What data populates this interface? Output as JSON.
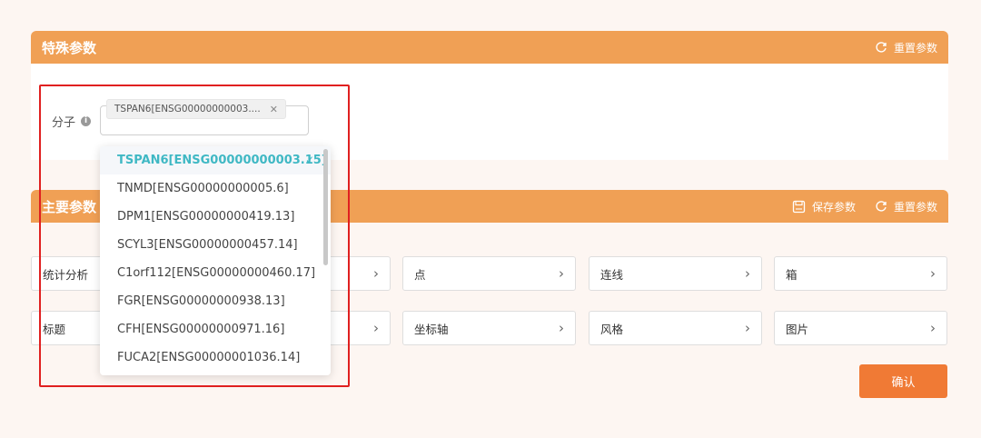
{
  "special_params": {
    "title": "特殊参数",
    "reset_label": "重置参数"
  },
  "molecule_field": {
    "label": "分子",
    "selected_tag": "TSPAN6[ENSG00000000003....",
    "options": [
      "TSPAN6[ENSG00000000003.15]",
      "TNMD[ENSG00000000005.6]",
      "DPM1[ENSG00000000419.13]",
      "SCYL3[ENSG00000000457.14]",
      "C1orf112[ENSG00000000460.17]",
      "FGR[ENSG00000000938.13]",
      "CFH[ENSG00000000971.16]",
      "FUCA2[ENSG00000001036.14]"
    ],
    "selected_index": 0
  },
  "main_params": {
    "title": "主要参数",
    "save_label": "保存参数",
    "reset_label": "重置参数"
  },
  "items": {
    "stat": "统计分析",
    "point": "点",
    "line": "连线",
    "box": "箱",
    "title": "标题",
    "axis": "坐标轴",
    "style": "风格",
    "image": "图片"
  },
  "confirm_label": "确认",
  "colors": {
    "header": "#f0a055",
    "confirm": "#f07a35",
    "selected_option": "#3fb8c4",
    "highlight_border": "#e02020"
  },
  "icons": {
    "reset": "refresh-icon",
    "save": "save-icon",
    "info": "info-icon",
    "chevron": "chevron-right-icon",
    "check": "check-icon",
    "remove": "close-icon"
  }
}
